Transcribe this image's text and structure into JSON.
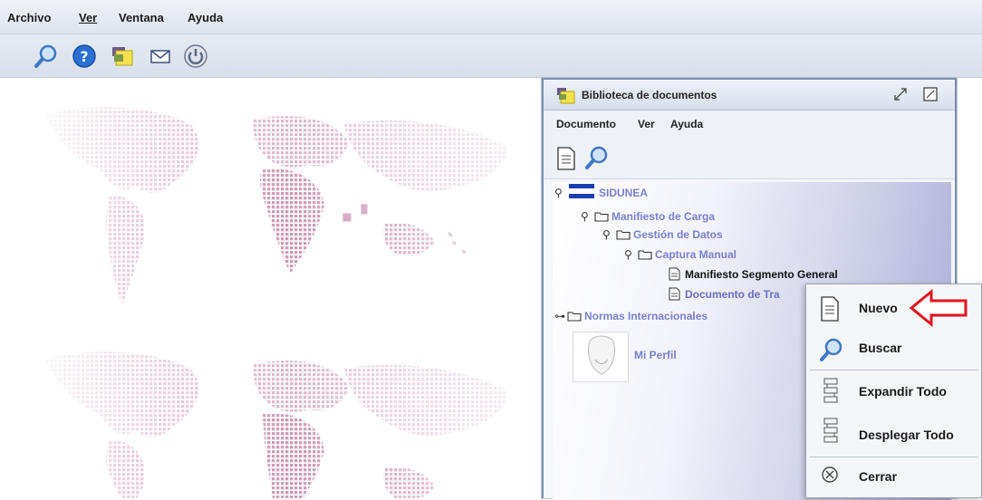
{
  "menubar": {
    "items": [
      "Archivo",
      "Ver",
      "Ventana",
      "Ayuda"
    ]
  },
  "toolbar": {
    "icons": [
      "search-icon",
      "help-icon",
      "library-icon",
      "mail-icon",
      "power-icon"
    ]
  },
  "library_window": {
    "title": "Biblioteca de documentos",
    "menu": [
      "Documento",
      "Ver",
      "Ayuda"
    ],
    "tools": [
      "new-document-icon",
      "search-icon"
    ],
    "tree": {
      "root": "SIDUNEA",
      "manifiesto": "Manifiesto de Carga",
      "gestion": "Gestión de Datos",
      "captura": "Captura Manual",
      "doc_general": "Manifiesto Segmento General",
      "doc_transporte": "Documento de Tra",
      "normas": "Normas Internacionales",
      "perfil": "Mi Perfil"
    }
  },
  "context_menu": {
    "items": [
      {
        "label": "Nuevo",
        "icon": "document-icon"
      },
      {
        "label": "Buscar",
        "icon": "search-icon"
      },
      {
        "label": "Expandir Todo",
        "icon": "tree-expand-icon"
      },
      {
        "label": "Desplegar Todo",
        "icon": "tree-collapse-icon"
      },
      {
        "label": "Cerrar",
        "icon": "close-circle-icon"
      }
    ]
  },
  "colors": {
    "highlight_arrow": "#e0141e",
    "tree_link": "#7a7fcf",
    "map_dots": "#c98fb0"
  }
}
